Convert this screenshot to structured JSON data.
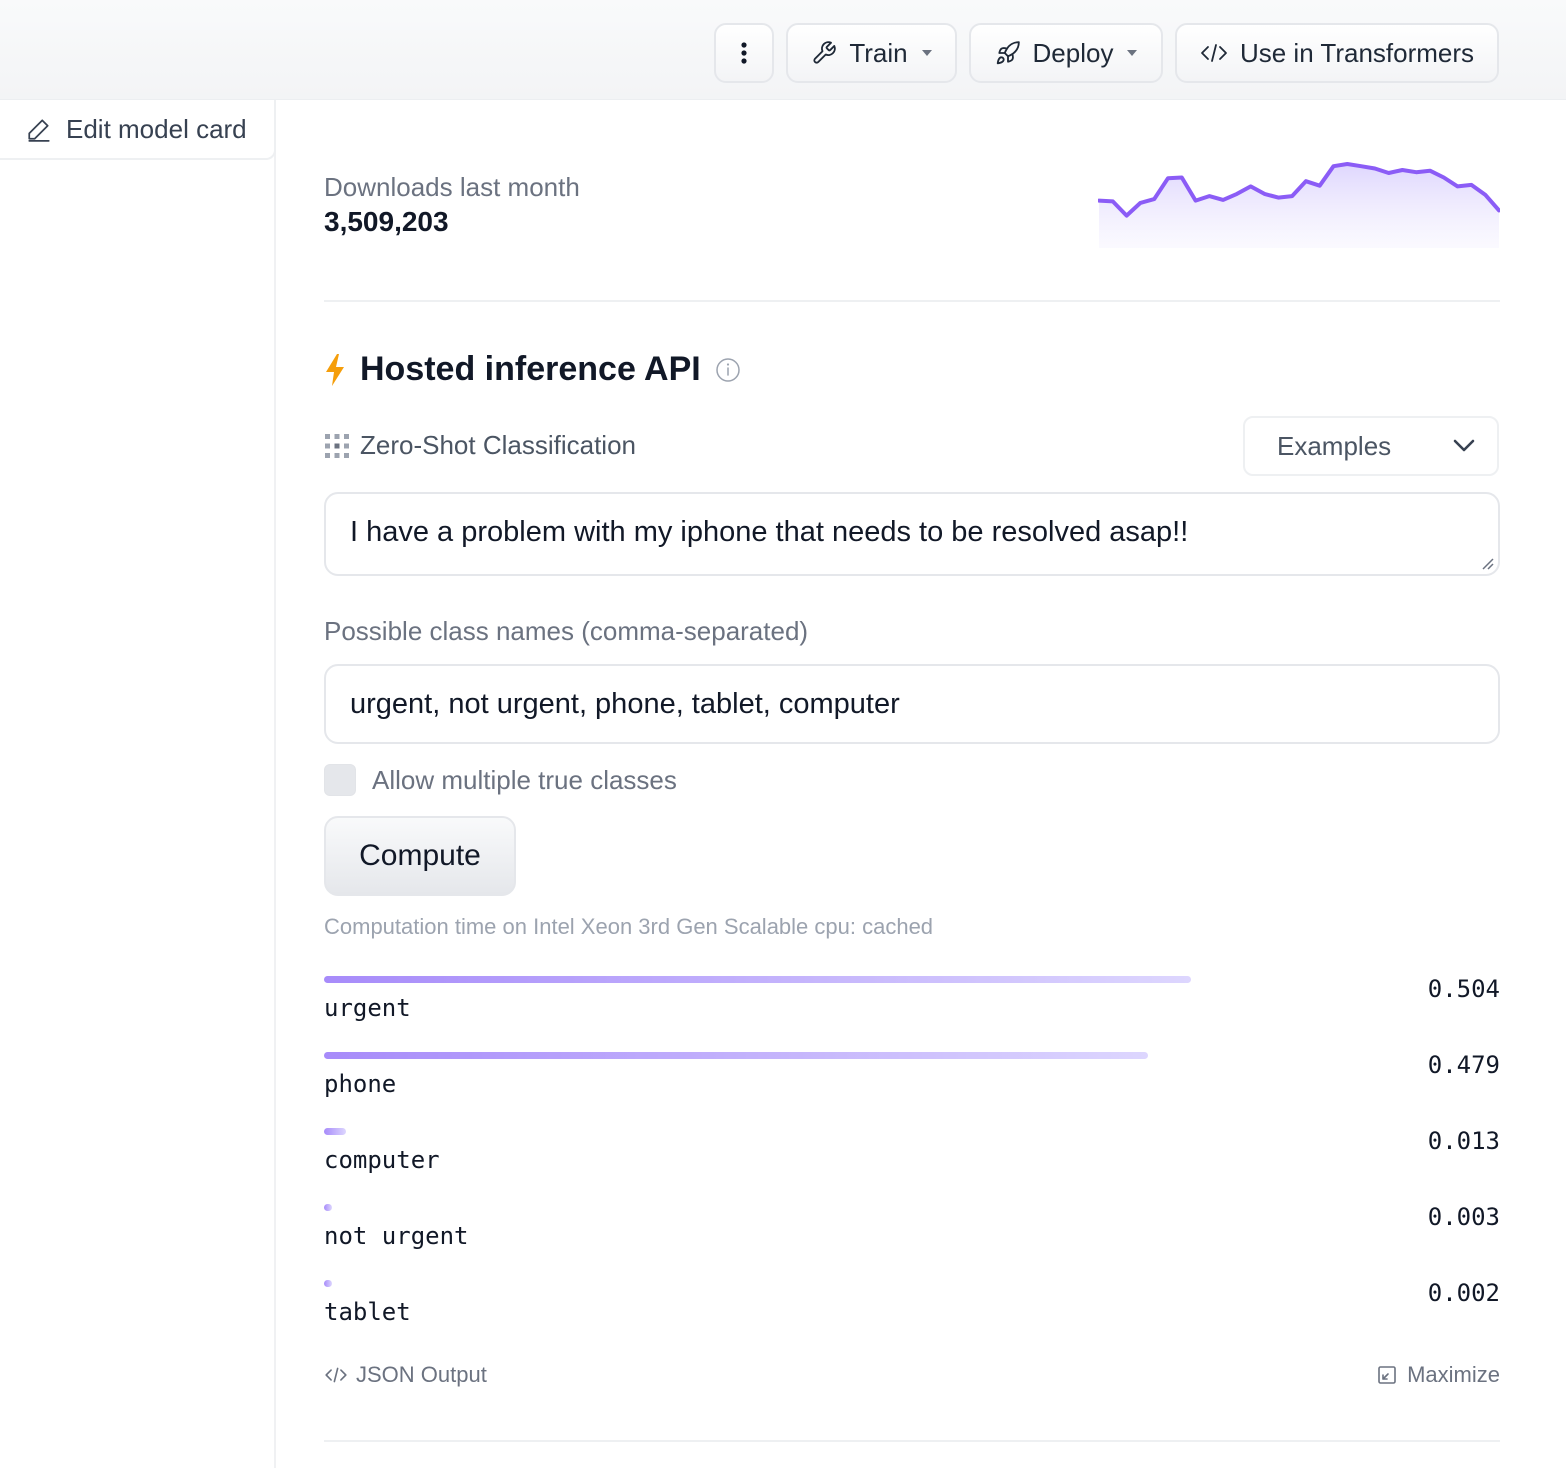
{
  "toolbar": {
    "more_icon": "more-vertical-icon",
    "train_label": "Train",
    "deploy_label": "Deploy",
    "transformers_label": "Use in Transformers"
  },
  "sidebar": {
    "edit_label": "Edit model card"
  },
  "downloads": {
    "label": "Downloads last month",
    "value": "3,509,203"
  },
  "chart_data": {
    "type": "area",
    "title": "",
    "color": "#8b5cf6",
    "values": [
      58,
      57,
      38,
      55,
      60,
      88,
      89,
      58,
      64,
      59,
      67,
      77,
      67,
      62,
      64,
      84,
      78,
      104,
      107,
      104,
      101,
      95,
      99,
      96,
      98,
      89,
      77,
      79,
      66,
      45
    ]
  },
  "inference": {
    "title": "Hosted inference API",
    "task": "Zero-Shot Classification",
    "examples_label": "Examples",
    "input_text": "I have a problem with my iphone that needs to be resolved asap!!",
    "classes_label": "Possible class names (comma-separated)",
    "classes_value": "urgent, not urgent, phone, tablet, computer",
    "multi_label": "Allow multiple true classes",
    "multi_checked": false,
    "compute_label": "Compute",
    "computation_time": "Computation time on Intel Xeon 3rd Gen Scalable cpu: cached",
    "results": [
      {
        "label": "urgent",
        "score": "0.504"
      },
      {
        "label": "phone",
        "score": "0.479"
      },
      {
        "label": "computer",
        "score": "0.013"
      },
      {
        "label": "not urgent",
        "score": "0.003"
      },
      {
        "label": "tablet",
        "score": "0.002"
      }
    ],
    "json_output_label": "JSON Output",
    "maximize_label": "Maximize"
  },
  "colors": {
    "accent": "#8b5cf6",
    "bolt": "#f59e0b"
  }
}
